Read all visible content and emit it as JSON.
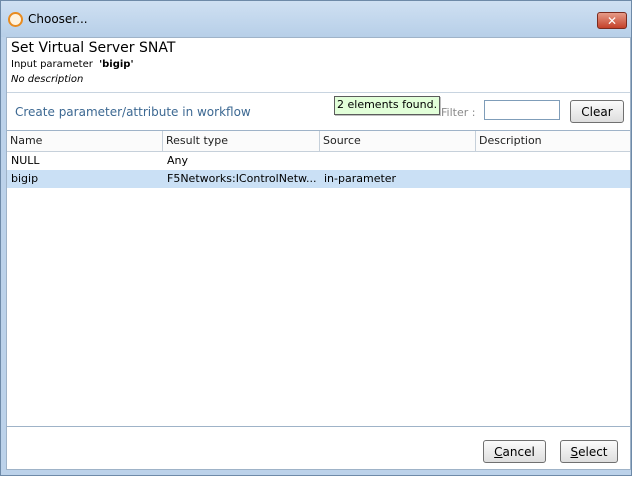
{
  "window": {
    "title": "Chooser..."
  },
  "header": {
    "title": "Set Virtual Server SNAT",
    "param_label": "Input parameter",
    "param_value": "'bigip'",
    "description": "No description"
  },
  "toolbar": {
    "create_link": "Create parameter/attribute in workflow",
    "tooltip": "2 elements found.",
    "filter_label": "Filter :",
    "filter_value": "",
    "clear_label": "Clear"
  },
  "table": {
    "columns": [
      "Name",
      "Result type",
      "Source",
      "Description"
    ],
    "rows": [
      {
        "name": "NULL",
        "result_type": "Any",
        "source": "",
        "description": ""
      },
      {
        "name": "bigip",
        "result_type": "F5Networks:IControlNetw...",
        "source": "in-parameter",
        "description": ""
      }
    ]
  },
  "footer": {
    "cancel_underlined": "C",
    "cancel_rest": "ancel",
    "select_underlined": "S",
    "select_rest": "elect"
  },
  "colors": {
    "selected_row": "#cae0f5",
    "tooltip_bg": "#e2ffd9",
    "link": "#3c6892"
  }
}
